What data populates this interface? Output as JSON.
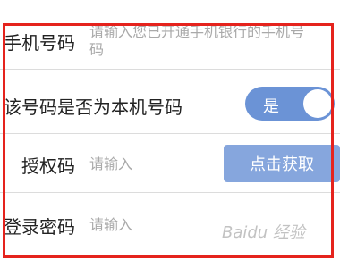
{
  "form": {
    "phone": {
      "label": "手机号码",
      "placeholder_line1": "请输入您已开通手机银行的手机号",
      "placeholder_line2": "码"
    },
    "is_own_number": {
      "label": "该号码是否为本机号码",
      "toggle_label": "是",
      "toggle_on": true
    },
    "auth_code": {
      "label": "授权码",
      "placeholder": "请输入",
      "button_label": "点击获取"
    },
    "login_password": {
      "label": "登录密码",
      "placeholder": "请输入"
    }
  },
  "overlay": {
    "watermark": "Baidu 经验"
  },
  "colors": {
    "highlight_border": "#e5231d",
    "accent": "#6b93d6",
    "button": "#86a6dd"
  }
}
